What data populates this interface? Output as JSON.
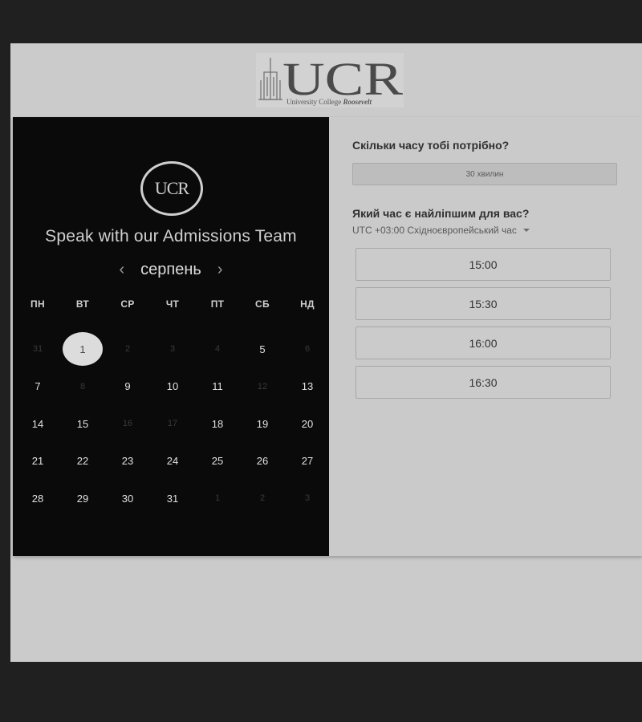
{
  "logo": {
    "letters": "UCR",
    "caption_main": "University College ",
    "caption_emphasis": "Roosevelt",
    "badge_text": "UCR"
  },
  "left": {
    "title": "Speak with our Admissions Team",
    "month": "серпень",
    "prev_icon": "chevron-left-icon",
    "next_icon": "chevron-right-icon",
    "weekdays": [
      "ПН",
      "ВТ",
      "СР",
      "ЧТ",
      "ПТ",
      "СБ",
      "НД"
    ],
    "days": [
      {
        "label": "31",
        "state": "muted"
      },
      {
        "label": "1",
        "state": "selected"
      },
      {
        "label": "2",
        "state": "muted"
      },
      {
        "label": "3",
        "state": "muted"
      },
      {
        "label": "4",
        "state": "muted"
      },
      {
        "label": "5",
        "state": "available"
      },
      {
        "label": "6",
        "state": "muted"
      },
      {
        "label": "7",
        "state": "available"
      },
      {
        "label": "8",
        "state": "muted"
      },
      {
        "label": "9",
        "state": "available"
      },
      {
        "label": "10",
        "state": "available"
      },
      {
        "label": "11",
        "state": "available"
      },
      {
        "label": "12",
        "state": "muted"
      },
      {
        "label": "13",
        "state": "available"
      },
      {
        "label": "14",
        "state": "available"
      },
      {
        "label": "15",
        "state": "available"
      },
      {
        "label": "16",
        "state": "muted"
      },
      {
        "label": "17",
        "state": "muted"
      },
      {
        "label": "18",
        "state": "available"
      },
      {
        "label": "19",
        "state": "available"
      },
      {
        "label": "20",
        "state": "available"
      },
      {
        "label": "21",
        "state": "available"
      },
      {
        "label": "22",
        "state": "available"
      },
      {
        "label": "23",
        "state": "available"
      },
      {
        "label": "24",
        "state": "available"
      },
      {
        "label": "25",
        "state": "available"
      },
      {
        "label": "26",
        "state": "available"
      },
      {
        "label": "27",
        "state": "available"
      },
      {
        "label": "28",
        "state": "available"
      },
      {
        "label": "29",
        "state": "available"
      },
      {
        "label": "30",
        "state": "available"
      },
      {
        "label": "31",
        "state": "available"
      },
      {
        "label": "1",
        "state": "muted"
      },
      {
        "label": "2",
        "state": "muted"
      },
      {
        "label": "3",
        "state": "muted"
      }
    ]
  },
  "right": {
    "duration_question": "Скільки часу тобі потрібно?",
    "duration_value": "30 хвилин",
    "time_question": "Який час є найліпшим для вас?",
    "timezone": "UTC +03:00 Східноєвропейський час",
    "slots": [
      "15:00",
      "15:30",
      "16:00",
      "16:30"
    ]
  },
  "colors": {
    "page_bg": "#202020",
    "frame_bg": "#cbcbcb",
    "calendar_bg": "#0a0a0a",
    "selected_day": "#dcdcdc"
  }
}
